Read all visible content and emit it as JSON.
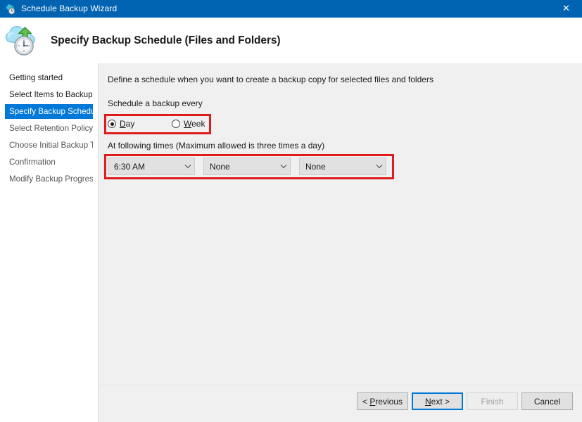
{
  "window": {
    "title": "Schedule Backup Wizard",
    "title_icon": "backup-cloud-clock-icon",
    "close_label": "✕",
    "titlebar_color": "#0063b1"
  },
  "header": {
    "icon": "cloud-upload-clock-icon",
    "title": "Specify Backup Schedule (Files and Folders)"
  },
  "sidebar": {
    "items": [
      {
        "label": "Getting started",
        "state": "done"
      },
      {
        "label": "Select Items to Backup",
        "state": "done"
      },
      {
        "label": "Specify Backup Schedu...",
        "state": "current"
      },
      {
        "label": "Select Retention Policy ...",
        "state": "pending"
      },
      {
        "label": "Choose Initial Backup T...",
        "state": "pending"
      },
      {
        "label": "Confirmation",
        "state": "pending"
      },
      {
        "label": "Modify Backup Progress",
        "state": "pending"
      }
    ],
    "highlight_color": "#0078d7"
  },
  "content": {
    "intro_text": "Define a schedule when you want to create a backup copy for selected files and folders",
    "schedule_label": "Schedule a backup every",
    "times_label": "At following times (Maximum allowed is three times a day)",
    "frequency": {
      "selected": "Day",
      "options": [
        {
          "label": "Day",
          "accel": "D",
          "checked": true
        },
        {
          "label": "Week",
          "accel": "W",
          "checked": false
        }
      ]
    },
    "time_dropdowns": [
      {
        "value": "6:30 AM",
        "arrow": "chevron-down-icon"
      },
      {
        "value": "None",
        "arrow": "chevron-down-icon"
      },
      {
        "value": "None",
        "arrow": "chevron-down-icon"
      }
    ],
    "annotations": [
      {
        "name": "frequency-highlight",
        "color": "#e01b1b"
      },
      {
        "name": "times-highlight",
        "color": "#e01b1b"
      }
    ]
  },
  "footer": {
    "buttons": [
      {
        "label": "< Previous",
        "accel": "P",
        "state": "enabled",
        "focused": false
      },
      {
        "label": "Next >",
        "accel": "N",
        "state": "enabled",
        "focused": true
      },
      {
        "label": "Finish",
        "accel": "",
        "state": "disabled",
        "focused": false
      },
      {
        "label": "Cancel",
        "accel": "",
        "state": "enabled",
        "focused": false
      }
    ],
    "focus_color": "#0078d7"
  }
}
